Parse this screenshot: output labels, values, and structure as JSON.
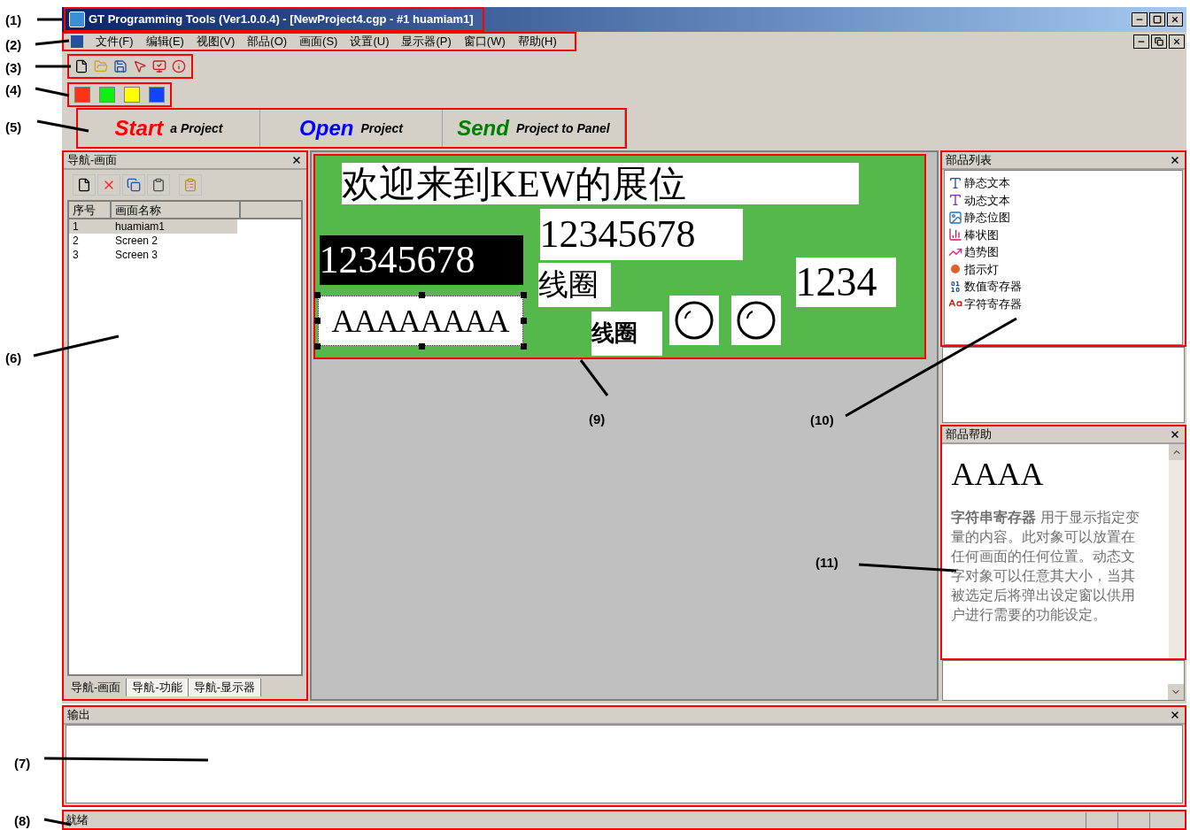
{
  "callouts": [
    "(1)",
    "(2)",
    "(3)",
    "(4)",
    "(5)",
    "(6)",
    "(7)",
    "(8)",
    "(9)",
    "(10)",
    "(11)"
  ],
  "window": {
    "title": "GT Programming Tools (Ver1.0.0.4) - [NewProject4.cgp - #1 huamiam1]"
  },
  "menu": [
    "文件(F)",
    "编辑(E)",
    "视图(V)",
    "部品(O)",
    "画面(S)",
    "设置(U)",
    "显示器(P)",
    "窗口(W)",
    "帮助(H)"
  ],
  "color_toolbar": [
    {
      "color": "#ff3311"
    },
    {
      "color": "#11ee11"
    },
    {
      "color": "#ffff00"
    },
    {
      "color": "#1144ff"
    }
  ],
  "quick_buttons": [
    {
      "keyword": "Start",
      "rest": "a Project",
      "color": "#ff0000"
    },
    {
      "keyword": "Open",
      "rest": "Project",
      "color": "#0000ff"
    },
    {
      "keyword": "Send",
      "rest": "Project to Panel",
      "color": "#008000"
    }
  ],
  "navigator": {
    "title": "导航-画面",
    "columns": [
      "序号",
      "画面名称"
    ],
    "rows": [
      {
        "index": "1",
        "name": "huamiam1",
        "selected": true
      },
      {
        "index": "2",
        "name": "Screen 2",
        "selected": false
      },
      {
        "index": "3",
        "name": "Screen 3",
        "selected": false
      }
    ],
    "tabs": [
      {
        "label": "导航-画面",
        "selected": true
      },
      {
        "label": "导航-功能",
        "selected": false
      },
      {
        "label": "导航-显示器",
        "selected": false
      }
    ]
  },
  "canvas": {
    "items": [
      {
        "kind": "label",
        "text": "欢迎来到KEW的展位",
        "inverse": false,
        "selected": false
      },
      {
        "kind": "label",
        "text": "12345678",
        "inverse": false,
        "selected": false
      },
      {
        "kind": "label",
        "text": "12345678",
        "inverse": true,
        "selected": false
      },
      {
        "kind": "label",
        "text": "线圈",
        "inverse": false,
        "selected": false
      },
      {
        "kind": "label",
        "text": "1234",
        "inverse": false,
        "selected": false
      },
      {
        "kind": "label",
        "text": "AAAAAAAA",
        "inverse": false,
        "selected": true
      },
      {
        "kind": "label",
        "text": "线圈",
        "inverse": false,
        "selected": false
      },
      {
        "kind": "lamp"
      },
      {
        "kind": "lamp"
      }
    ]
  },
  "parts_list": {
    "title": "部品列表",
    "items": [
      "静态文本",
      "动态文本",
      "静态位图",
      "棒状图",
      "趋势图",
      "指示灯",
      "数值寄存器",
      "字符寄存器"
    ]
  },
  "parts_help": {
    "title": "部品帮助",
    "preview": "AAAA",
    "description": "**字符串寄存器** 用于显示指定变量的内容。此对象可以放置在任何画面的任何位置。动态文字对象可以任意其大小，当其被选定后将弹出设定窗以供用户进行需要的功能设定。"
  },
  "output": {
    "title": "输出"
  },
  "status_bar": {
    "text": "就绪"
  }
}
